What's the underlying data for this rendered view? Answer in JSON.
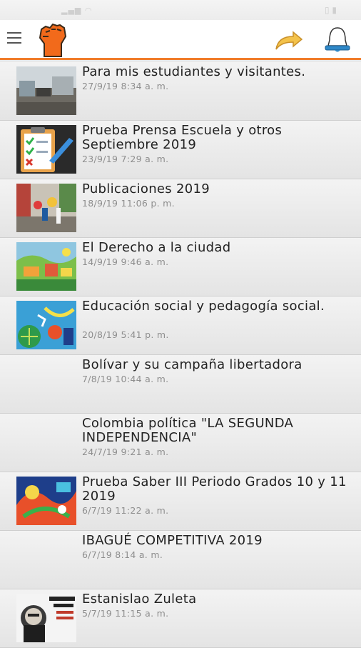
{
  "header": {
    "menu_icon": "hamburger-menu-icon",
    "logo_icon": "raised-fist-logo-icon",
    "share_icon": "share-arrow-icon",
    "bell_icon": "notification-bell-icon",
    "accent_color": "#f07c2a"
  },
  "posts": [
    {
      "title": "Para mis estudiantes y visitantes.",
      "date": "27/9/19 8:34 a. m.",
      "thumb": "street-photo"
    },
    {
      "title": "Prueba Prensa Escuela y otros Septiembre 2019",
      "date": "23/9/19 7:29 a. m.",
      "thumb": "checklist-clipboard"
    },
    {
      "title": "Publicaciones 2019",
      "date": "18/9/19 11:06 p. m.",
      "thumb": "street-parade-photo"
    },
    {
      "title": "El Derecho a la ciudad",
      "date": "14/9/19 9:46 a. m.",
      "thumb": "colorful-city-illustration"
    },
    {
      "title": "Educación social y pedagogía social.",
      "date": "20/8/19 5:41 p. m.",
      "thumb": "colorful-mural-illustration"
    },
    {
      "title": "Bolívar y su campaña libertadora",
      "date": "7/8/19 10:44 a. m.",
      "thumb": ""
    },
    {
      "title": "Colombia política \"LA SEGUNDA INDEPENDENCIA\"",
      "date": "24/7/19 9:21 a. m.",
      "thumb": ""
    },
    {
      "title": "Prueba Saber III Periodo Grados 10 y 11 2019",
      "date": "6/7/19 11:22 a. m.",
      "thumb": "colorful-abstract-illustration"
    },
    {
      "title": "IBAGUÉ COMPETITIVA 2019",
      "date": "6/7/19 8:14 a. m.",
      "thumb": ""
    },
    {
      "title": "Estanislao Zuleta",
      "date": "5/7/19 11:15 a. m.",
      "thumb": "portrait-book-cover"
    }
  ]
}
